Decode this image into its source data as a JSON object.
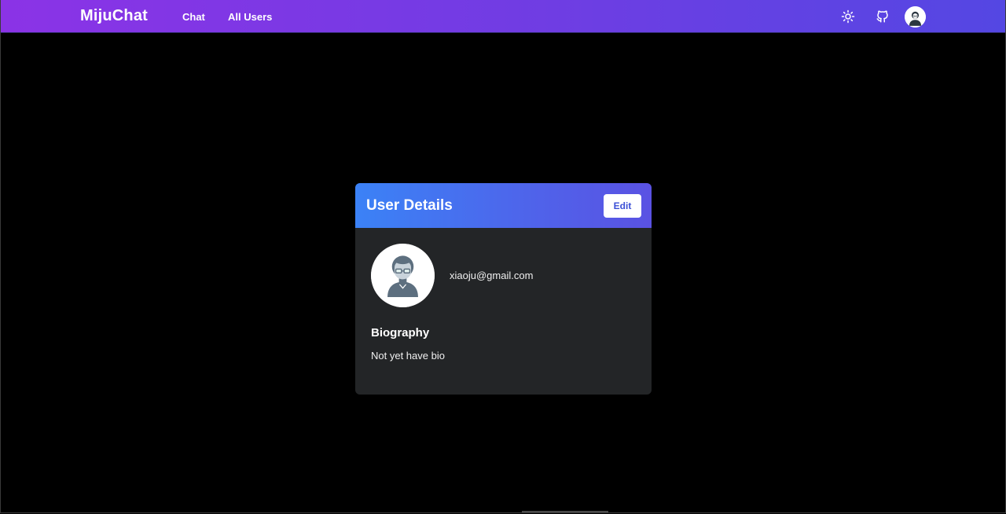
{
  "navbar": {
    "brand": "MijuChat",
    "links": [
      {
        "label": "Chat"
      },
      {
        "label": "All Users"
      }
    ],
    "icons": [
      "sun-icon",
      "github-icon",
      "user-avatar-icon"
    ]
  },
  "card": {
    "title": "User Details",
    "edit_label": "Edit",
    "email": "xiaoju@gmail.com",
    "bio_heading": "Biography",
    "bio_text": "Not yet have bio"
  },
  "colors": {
    "navbar_gradient": [
      "#8b33e6",
      "#5447e3"
    ],
    "header_gradient": [
      "#3b82f6",
      "#5a52e3"
    ],
    "card_bg": "#232527",
    "page_bg": "#000000",
    "avatar_figure": "#5d6f7f"
  }
}
